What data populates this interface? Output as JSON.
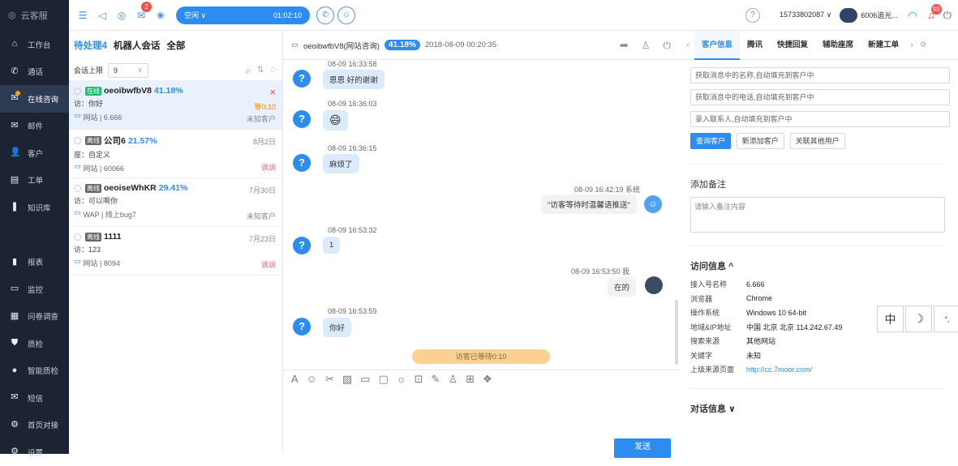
{
  "app": {
    "logo": "云客服"
  },
  "sidebar": {
    "items": [
      {
        "label": "工作台",
        "icon": "⌂"
      },
      {
        "label": "通话",
        "icon": "✆"
      },
      {
        "label": "在线咨询",
        "icon": "✉",
        "active": true
      },
      {
        "label": "邮件",
        "icon": "✉"
      },
      {
        "label": "客户",
        "icon": "👤"
      },
      {
        "label": "工单",
        "icon": "▤"
      },
      {
        "label": "知识库",
        "icon": "❚"
      },
      {
        "label": "",
        "icon": ""
      },
      {
        "label": "报表",
        "icon": "▮"
      },
      {
        "label": "监控",
        "icon": "▭"
      },
      {
        "label": "问卷调查",
        "icon": "▦"
      },
      {
        "label": "质检",
        "icon": "⛊"
      },
      {
        "label": "智能质检",
        "icon": "●"
      },
      {
        "label": "短信",
        "icon": "✉"
      },
      {
        "label": "首页对接",
        "icon": "⚙"
      },
      {
        "label": "设置",
        "icon": "⚙"
      }
    ]
  },
  "topbar": {
    "badge_count": "2",
    "status": "空闲 ∨",
    "timer": "01:02:10",
    "phone": "15733802087 ∨",
    "user": "6006追光...",
    "notify_count": "99"
  },
  "sessions": {
    "tabs": [
      "待处理4",
      "机器人会话",
      "全部"
    ],
    "limit_label": "会话上限",
    "limit_value": "9",
    "items": [
      {
        "tag": "在线",
        "name": "oeoibwfbV8",
        "pct": "41.18%",
        "time": "",
        "wait": "等0:10",
        "msg": "访：你好",
        "source": "网站 | 6.666",
        "cust": "未知客户"
      },
      {
        "tag": "离线",
        "name": "公司6",
        "pct": "21.57%",
        "time": "8月2日",
        "msg": "座：自定义",
        "source": "网站 | 60066",
        "cust": "飒飒"
      },
      {
        "tag": "离线",
        "name": "oeoiseWhKR",
        "pct": "29.41%",
        "time": "7月30日",
        "msg": "访：可以啊你",
        "source": "WAP | 线上bug7",
        "cust": "未知客户"
      },
      {
        "tag": "离线",
        "name": "1111",
        "pct": "",
        "time": "7月23日",
        "msg": "访：123",
        "source": "网站 | 8094",
        "cust": "飒飒"
      }
    ]
  },
  "chat": {
    "title": "oeoibwfbV8(网站咨询)",
    "pct": "41.18%",
    "datetime": "2018-08-09 00:20:35",
    "messages": [
      {
        "time": "08-09 16:33:58",
        "text": "恩恩 好的谢谢"
      },
      {
        "time": "08-09 16:36:03",
        "text": "😄"
      },
      {
        "time": "08-09 16:36:15",
        "text": "麻烦了"
      },
      {
        "time": "08-09 16:42:19 系统",
        "text": "\"访客等待时温馨语推送\""
      },
      {
        "time": "08-09 16:53:32",
        "text": "1"
      },
      {
        "time": "08-09 16:53:50 我",
        "text": "在的"
      },
      {
        "time": "08-09 16:53:59",
        "text": "你好"
      }
    ],
    "wait_tip": "访客已等待0:10",
    "send": "发送"
  },
  "right": {
    "tabs": [
      "客户信息",
      "腾讯",
      "快捷回复",
      "辅助座席",
      "新建工单"
    ],
    "name_ph": "获取消息中的名称,自动填充到客户中",
    "phone_ph": "获取消息中的电话,自动填充到客户中",
    "contact_ph": "录入联系人,自动填充到客户中",
    "btn_query": "查询客户",
    "btn_new": "新添加客户",
    "btn_link": "关联其他用户",
    "note_title": "添加备注",
    "note_ph": "请输入备注内容",
    "visit_title": "访问信息 ^",
    "visit": [
      {
        "k": "接入号名称",
        "v": "6.666"
      },
      {
        "k": "浏览器",
        "v": "Chrome"
      },
      {
        "k": "操作系统",
        "v": "Windows 10 64-bit"
      },
      {
        "k": "地域&IP地址",
        "v": "中国 北京 北京 114.242.67.49"
      },
      {
        "k": "搜索来源",
        "v": "其他网站"
      },
      {
        "k": "关键字",
        "v": "未知"
      },
      {
        "k": "上级来源页面",
        "v": "http://cc.7moor.com/"
      }
    ],
    "dialog_title": "对话信息 ∨"
  },
  "ime": {
    "zh": "中"
  }
}
